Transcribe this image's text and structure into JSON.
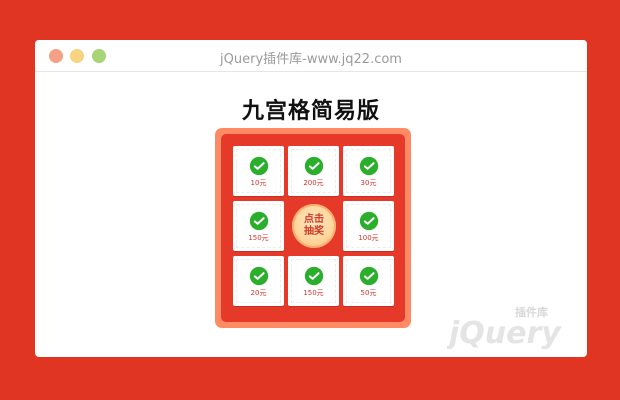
{
  "window": {
    "title": "jQuery插件库-www.jq22.com"
  },
  "heading": "九宫格简易版",
  "lottery": {
    "prizes": [
      "10元",
      "200元",
      "30元",
      "100元",
      "50元",
      "150元",
      "20元",
      "150元"
    ],
    "start_line1": "点击",
    "start_line2": "抽奖"
  },
  "watermark": {
    "brand": "jQuery",
    "brand_cn": "插件库"
  },
  "colors": {
    "background": "#e13524",
    "panel_border": "#ff8a63",
    "panel_inner": "#e5392a",
    "prize_text": "#d0352a",
    "wechat_green": "#2aae2b"
  },
  "icons": {
    "prize": "wechat-icon"
  }
}
